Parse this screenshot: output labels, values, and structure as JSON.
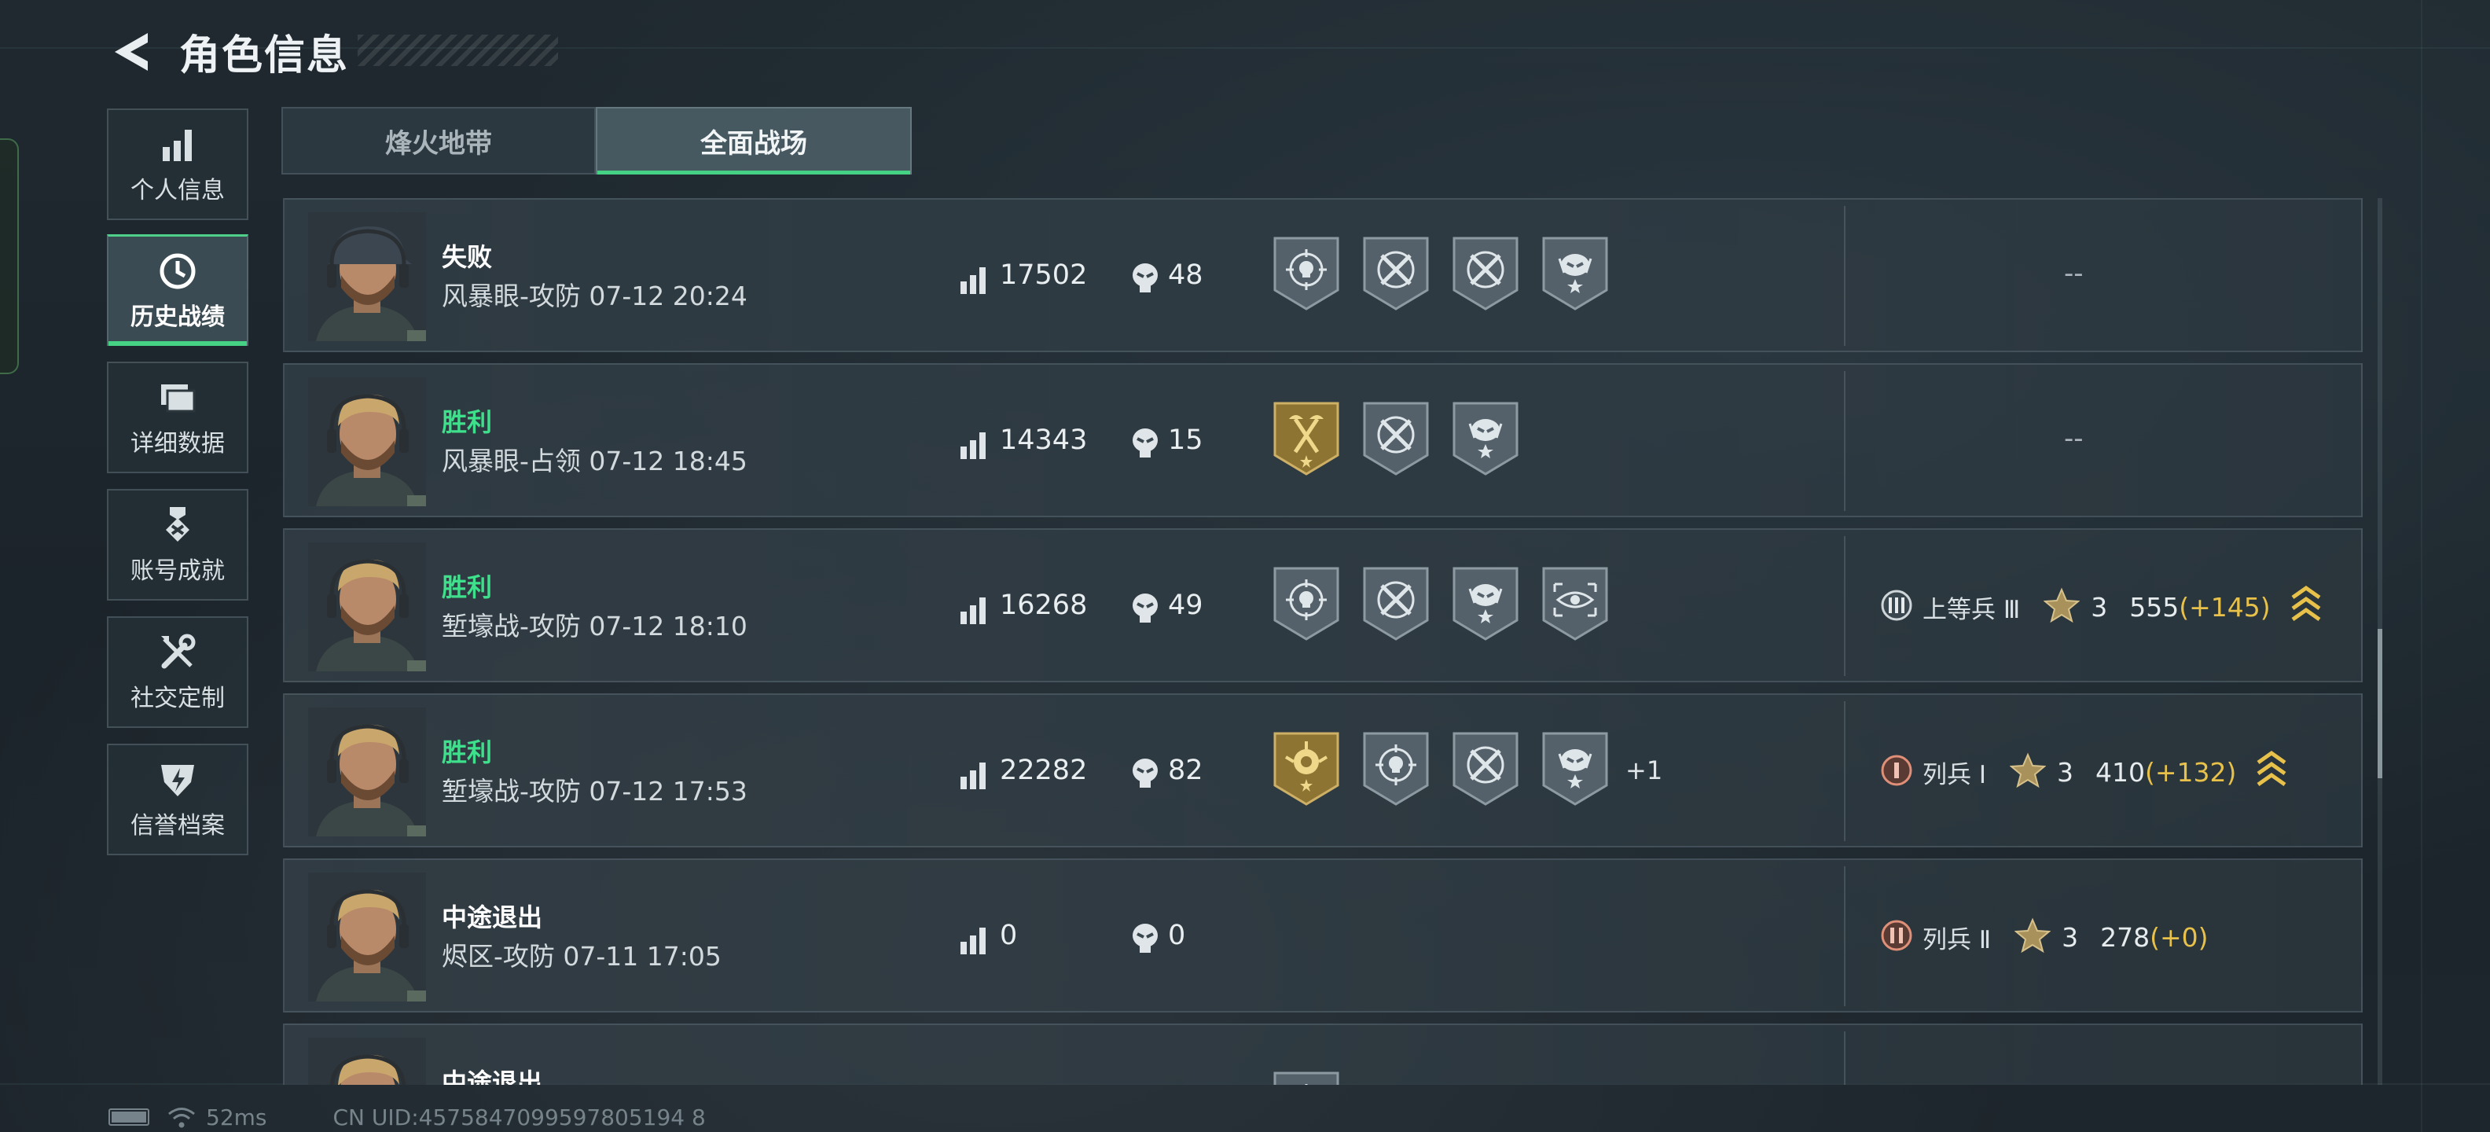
{
  "header": {
    "title": "角色信息"
  },
  "sidebar": {
    "items": [
      {
        "label": "个人信息",
        "icon": "bar-chart-icon"
      },
      {
        "label": "历史战绩",
        "icon": "clock-icon",
        "active": true
      },
      {
        "label": "详细数据",
        "icon": "folder-icon"
      },
      {
        "label": "账号成就",
        "icon": "medal-icon"
      },
      {
        "label": "社交定制",
        "icon": "tools-icon"
      },
      {
        "label": "信誉档案",
        "icon": "shield-bolt-icon"
      }
    ]
  },
  "tabs": [
    {
      "label": "烽火地带",
      "active": false
    },
    {
      "label": "全面战场",
      "active": true
    }
  ],
  "matches": [
    {
      "result": "失败",
      "win": false,
      "detail": "风暴眼-攻防 07-12 20:24",
      "score": "17502",
      "kills": "48",
      "badges": [
        "skull-target-badge",
        "crossed-rifle-badge",
        "crossed-rifle-badge",
        "alien-star-badge"
      ],
      "more": "",
      "rank": null,
      "placeholder": "--"
    },
    {
      "result": "胜利",
      "win": true,
      "detail": "风暴眼-占领 07-12 18:45",
      "score": "14343",
      "kills": "15",
      "badges": [
        "gold-axes-badge",
        "crossed-rifle-badge",
        "alien-star-badge"
      ],
      "more": "",
      "rank": null,
      "placeholder": "--"
    },
    {
      "result": "胜利",
      "win": true,
      "detail": "堑壕战-攻防 07-12 18:10",
      "score": "16268",
      "kills": "49",
      "badges": [
        "skull-target-badge",
        "crossed-rifle-badge",
        "alien-star-badge",
        "eye-scope-badge"
      ],
      "more": "",
      "rank": {
        "numeral": "III",
        "name": "上等兵 Ⅲ",
        "stars": "3",
        "points": "555",
        "delta": "(+145)",
        "promoted": true
      },
      "placeholder": ""
    },
    {
      "result": "胜利",
      "win": true,
      "detail": "堑壕战-攻防 07-12 17:53",
      "score": "22282",
      "kills": "82",
      "badges": [
        "gold-flower-badge",
        "skull-target-badge",
        "crossed-rifle-badge",
        "alien-star-badge"
      ],
      "more": "+1",
      "rank": {
        "numeral": "I",
        "name": "列兵 Ⅰ",
        "stars": "3",
        "points": "410",
        "delta": "(+132)",
        "promoted": true
      },
      "placeholder": ""
    },
    {
      "result": "中途退出",
      "win": false,
      "detail": "烬区-攻防 07-11 17:05",
      "score": "0",
      "kills": "0",
      "badges": [],
      "more": "",
      "rank": {
        "numeral": "II",
        "name": "列兵 Ⅱ",
        "stars": "3",
        "points": "278",
        "delta": "(+0)",
        "promoted": false
      },
      "placeholder": ""
    },
    {
      "result": "中途退出",
      "win": false,
      "detail": "",
      "score": "",
      "kills": "",
      "badges": [
        "skull-target-badge"
      ],
      "more": "",
      "rank": null,
      "placeholder": ""
    }
  ],
  "status_bar": {
    "ping": "52ms",
    "uid": "CN UID:4575847099597805194 8"
  },
  "colors": {
    "accent_green": "#46d285",
    "win_text": "#3fe08c",
    "delta_gold": "#e7c14a"
  }
}
